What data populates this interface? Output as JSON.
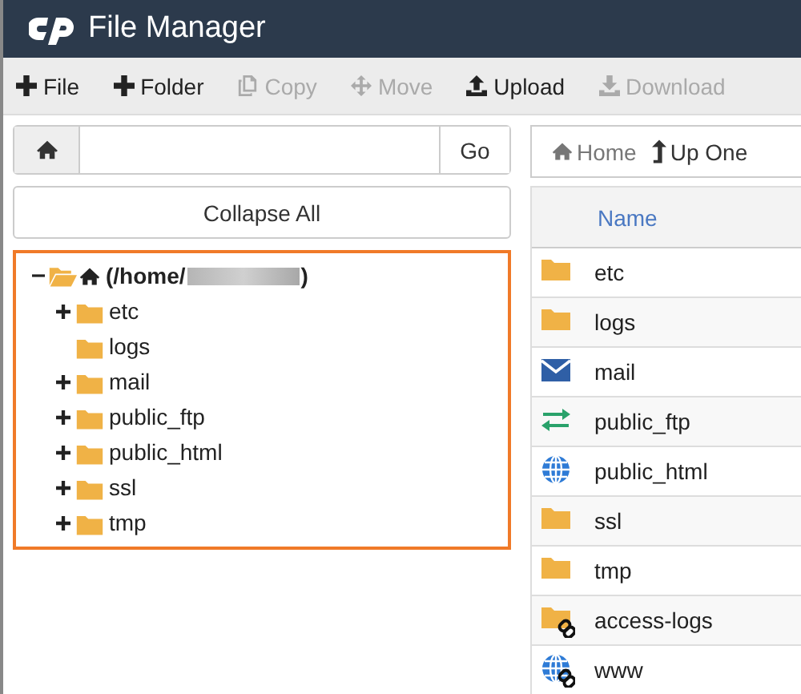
{
  "window": {
    "title": "File Manager"
  },
  "toolbar": [
    {
      "label": "File",
      "disabled": false
    },
    {
      "label": "Folder",
      "disabled": false
    },
    {
      "label": "Copy",
      "disabled": true
    },
    {
      "label": "Move",
      "disabled": true
    },
    {
      "label": "Upload",
      "disabled": false
    },
    {
      "label": "Download",
      "disabled": true
    }
  ],
  "path_bar": {
    "button": "Go"
  },
  "collapse_button": "Collapse All",
  "tree": {
    "label_start": "(/home/",
    "label_end": ")",
    "expanded": true,
    "children": [
      {
        "label": "etc",
        "expandable": true
      },
      {
        "label": "logs",
        "expandable": false
      },
      {
        "label": "mail",
        "expandable": true
      },
      {
        "label": "public_ftp",
        "expandable": true
      },
      {
        "label": "public_html",
        "expandable": true
      },
      {
        "label": "ssl",
        "expandable": true
      },
      {
        "label": "tmp",
        "expandable": true
      }
    ]
  },
  "nav": [
    {
      "label": "Home"
    },
    {
      "label": "Up One"
    }
  ],
  "table": {
    "columns": [
      "Name"
    ],
    "rows": [
      {
        "name": "etc",
        "kind": "folder"
      },
      {
        "name": "logs",
        "kind": "folder"
      },
      {
        "name": "mail",
        "kind": "mail"
      },
      {
        "name": "public_ftp",
        "kind": "transfer"
      },
      {
        "name": "public_html",
        "kind": "globe"
      },
      {
        "name": "ssl",
        "kind": "folder"
      },
      {
        "name": "tmp",
        "kind": "folder"
      },
      {
        "name": "access-logs",
        "kind": "folder-link"
      },
      {
        "name": "www",
        "kind": "globe-link"
      }
    ]
  }
}
